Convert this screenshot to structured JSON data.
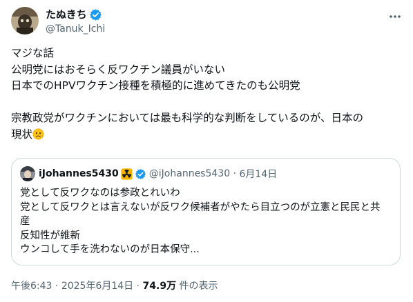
{
  "author": {
    "display_name": "たぬきち",
    "handle": "@Tanuk_Ichi",
    "verified_color": "#1d9bf0"
  },
  "tweet": {
    "text": "マジな話\n公明党にはおそらく反ワクチン議員がいない\n日本でのHPVワクチン接種を積極的に進めてきたのも公明党\n\n宗教政党がワクチンにおいては最も科学的な判断をしているのが、日本の\n現状",
    "trailing_emoji": "frowning-face-emoji"
  },
  "quote": {
    "display_name": "iJohannes5430",
    "badge_icon": "radioactive-icon",
    "handle": "@iJohannes5430",
    "separator": "·",
    "date": "6月14日",
    "text": "党として反ワクなのは参政とれいわ\n党として反ワクとは言えないが反ワク候補者がやたら目立つのが立憲と民民と共\n産\n反知性が維新\nウンコして手を洗わないのが日本保守..."
  },
  "footer": {
    "time": "午後6:43",
    "separator": "·",
    "date": "2025年6月14日",
    "separator2": "·",
    "views_count": "74.9万",
    "views_label": "件の表示"
  },
  "icons": {
    "more": "more-horizontal-icon",
    "verified": "verified-badge-icon"
  }
}
